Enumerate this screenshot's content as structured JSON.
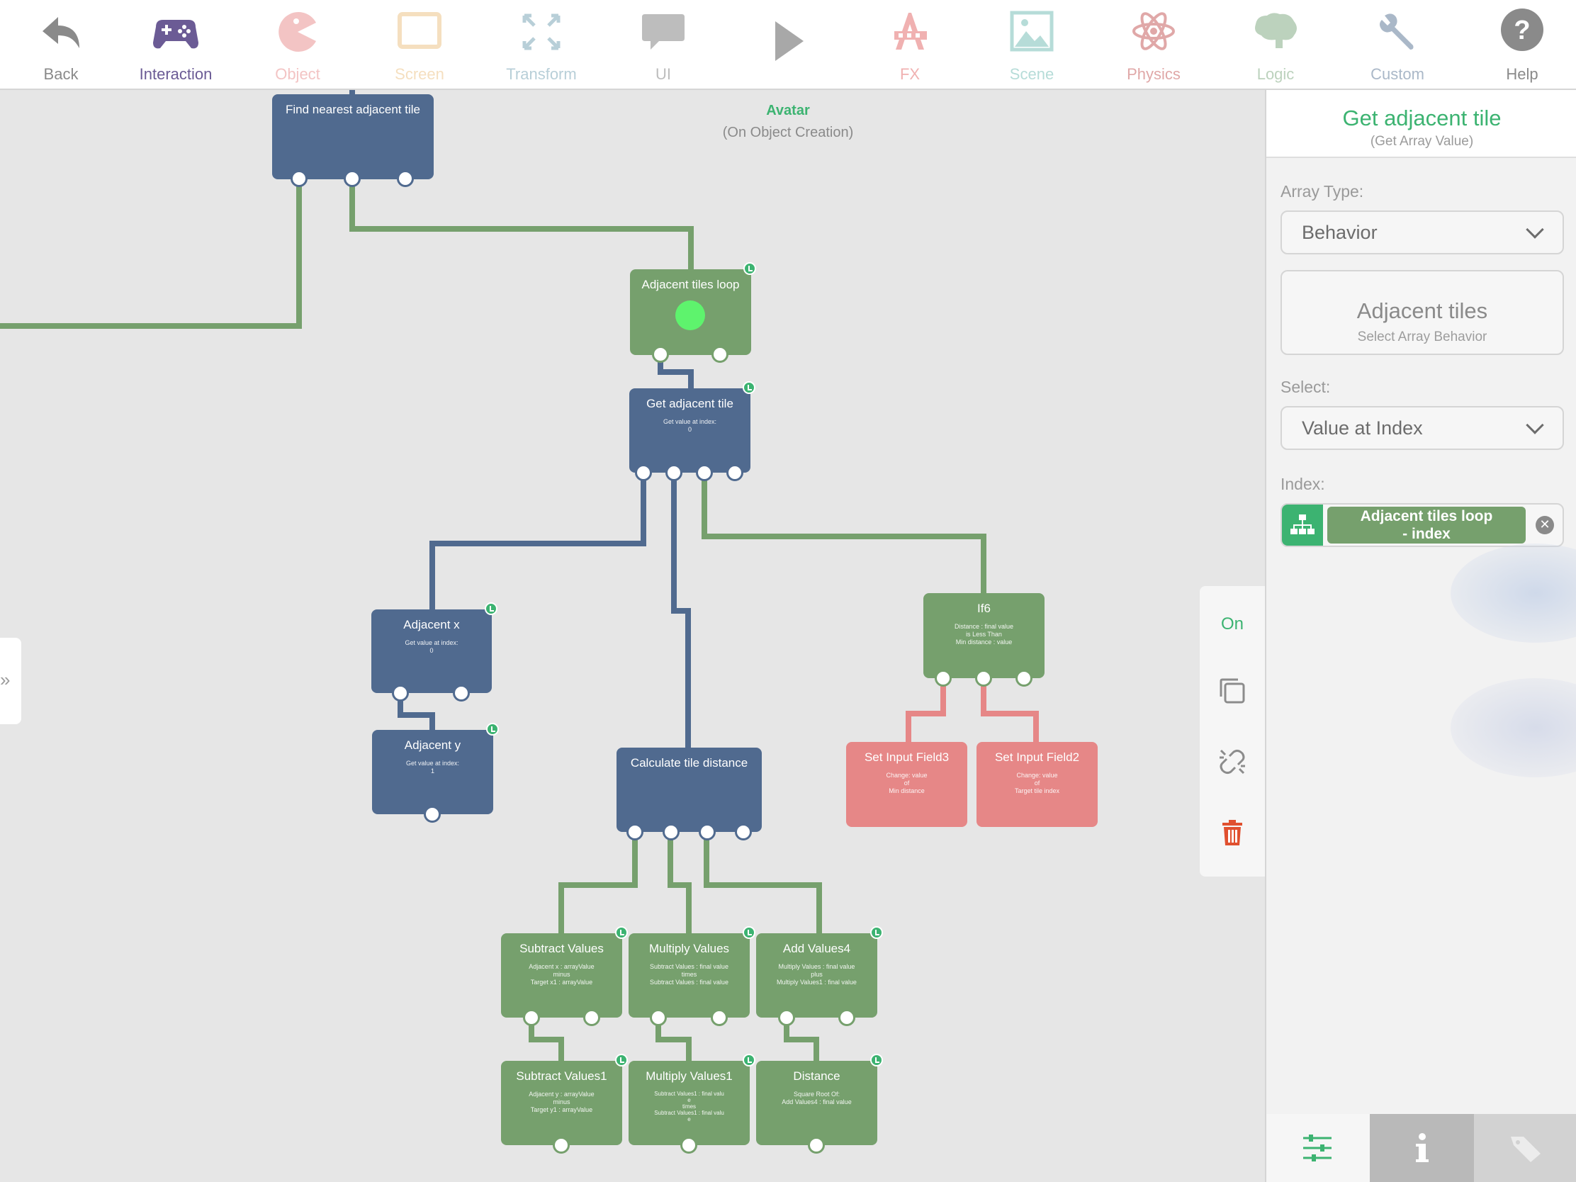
{
  "toolbar": {
    "items": [
      {
        "label": "Back",
        "icon": "back-arrow-icon",
        "color": "#8a8a8a"
      },
      {
        "label": "Interaction",
        "icon": "gamepad-icon",
        "color": "#6b5b95"
      },
      {
        "label": "Object",
        "icon": "pacman-icon",
        "color": "#f3c4c4"
      },
      {
        "label": "Screen",
        "icon": "screen-icon",
        "color": "#f5dfbf"
      },
      {
        "label": "Transform",
        "icon": "transform-arrows-icon",
        "color": "#b8cfd8"
      },
      {
        "label": "UI",
        "icon": "speech-bubble-icon",
        "color": "#bdbdbd"
      },
      {
        "label": "",
        "icon": "play-icon",
        "color": "#a8a8a8"
      },
      {
        "label": "FX",
        "icon": "fx-icon",
        "color": "#f0b1b1"
      },
      {
        "label": "Scene",
        "icon": "image-icon",
        "color": "#b6dcd8"
      },
      {
        "label": "Physics",
        "icon": "atom-icon",
        "color": "#e0a8a8"
      },
      {
        "label": "Logic",
        "icon": "brain-icon",
        "color": "#bcd2bd"
      },
      {
        "label": "Custom",
        "icon": "wrench-icon",
        "color": "#aab8c8"
      },
      {
        "label": "Help",
        "icon": "help-icon",
        "color": "#8a8a8a"
      }
    ]
  },
  "canvas": {
    "context_name": "Avatar",
    "context_event": "(On Object Creation)",
    "nodes": {
      "find_nearest": {
        "title": "Find nearest adjacent tile",
        "detail": []
      },
      "loop": {
        "title": "Adjacent tiles loop",
        "detail": []
      },
      "get_adjacent": {
        "title": "Get adjacent tile",
        "detail": [
          "Get value at index:",
          "0"
        ]
      },
      "adj_x": {
        "title": "Adjacent x",
        "detail": [
          "Get value at index:",
          "0"
        ]
      },
      "adj_y": {
        "title": "Adjacent y",
        "detail": [
          "Get value at index:",
          "1"
        ]
      },
      "calc": {
        "title": "Calculate tile distance",
        "detail": []
      },
      "if6": {
        "title": "If6",
        "detail": [
          "Distance : final value",
          "is Less Than",
          "Min distance : value"
        ]
      },
      "set3": {
        "title": "Set Input Field3",
        "detail": [
          "Change: value",
          "of",
          "Min distance"
        ]
      },
      "set2": {
        "title": "Set Input Field2",
        "detail": [
          "Change: value",
          "of",
          "Target tile index"
        ]
      },
      "sub": {
        "title": "Subtract Values",
        "detail": [
          "Adjacent x : arrayValue",
          "minus",
          "Target x1 : arrayValue"
        ]
      },
      "mul": {
        "title": "Multiply Values",
        "detail": [
          "Subtract Values : final value",
          "times",
          "Subtract Values : final value"
        ]
      },
      "add4": {
        "title": "Add Values4",
        "detail": [
          "Multiply Values : final value",
          "plus",
          "Multiply Values1 : final value"
        ]
      },
      "sub1": {
        "title": "Subtract Values1",
        "detail": [
          "Adjacent y : arrayValue",
          "minus",
          "Target y1 : arrayValue"
        ]
      },
      "mul1": {
        "title": "Multiply Values1",
        "detail": [
          "Subtract Values1 : final valu",
          "e",
          "times",
          "Subtract Values1 : final valu",
          "e"
        ]
      },
      "dist": {
        "title": "Distance",
        "detail": [
          "Square Root Of:",
          "Add Values4 : final value"
        ]
      }
    }
  },
  "actions": {
    "on_label": "On",
    "copy_icon": "copy-icon",
    "unlink_icon": "unlink-icon",
    "delete_icon": "trash-icon"
  },
  "panel": {
    "title": "Get adjacent tile",
    "subtitle": "(Get Array Value)",
    "array_type_label": "Array Type:",
    "array_type_value": "Behavior",
    "array_main": "Adjacent tiles",
    "array_hint": "Select Array Behavior",
    "select_label": "Select:",
    "select_value": "Value at Index",
    "index_label": "Index:",
    "index_line1": "Adjacent tiles loop",
    "index_line2": "- index",
    "tabs": [
      "sliders-icon",
      "info-icon",
      "tag-icon"
    ]
  },
  "colors": {
    "blue_node": "#506a8f",
    "green_node": "#76a06d",
    "red_node": "#e68787",
    "accent": "#3cb371"
  }
}
